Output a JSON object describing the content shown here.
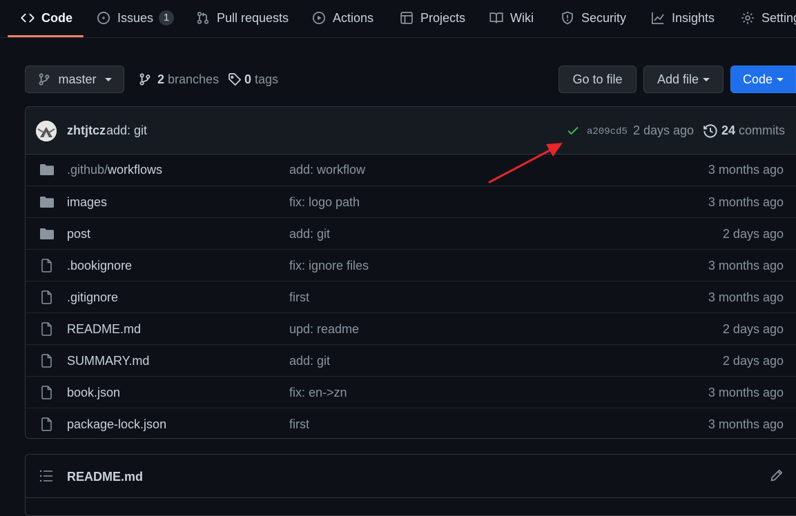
{
  "nav": {
    "tabs": [
      {
        "label": "Code",
        "icon": "code-icon",
        "active": true
      },
      {
        "label": "Issues",
        "icon": "issue-opened-icon",
        "count": "1"
      },
      {
        "label": "Pull requests",
        "icon": "git-pull-request-icon"
      },
      {
        "label": "Actions",
        "icon": "play-icon"
      },
      {
        "label": "Projects",
        "icon": "table-icon"
      },
      {
        "label": "Wiki",
        "icon": "book-icon"
      },
      {
        "label": "Security",
        "icon": "shield-icon"
      },
      {
        "label": "Insights",
        "icon": "graph-icon"
      },
      {
        "label": "Settings",
        "icon": "gear-icon"
      }
    ],
    "active_color": "#f78166"
  },
  "toolbar": {
    "branch": "master",
    "branches_count": "2",
    "branches_label": "branches",
    "tags_count": "0",
    "tags_label": "tags",
    "go_to_file": "Go to file",
    "add_file": "Add file",
    "code": "Code",
    "code_color": "#1f6feb"
  },
  "commit": {
    "author": "zhtjtcz",
    "message": "add: git",
    "status": "success",
    "status_color": "#3fb950",
    "sha": "a209cd5",
    "age": "2 days ago",
    "commits_count": "24",
    "commits_label": "commits"
  },
  "files": [
    {
      "type": "dir",
      "name_prefix": ".github/",
      "name": "workflows",
      "message": "add: workflow",
      "age": "3 months ago"
    },
    {
      "type": "dir",
      "name_prefix": "",
      "name": "images",
      "message": "fix: logo path",
      "age": "3 months ago"
    },
    {
      "type": "dir",
      "name_prefix": "",
      "name": "post",
      "message": "add: git",
      "age": "2 days ago"
    },
    {
      "type": "file",
      "name_prefix": "",
      "name": ".bookignore",
      "message": "fix: ignore files",
      "age": "3 months ago"
    },
    {
      "type": "file",
      "name_prefix": "",
      "name": ".gitignore",
      "message": "first",
      "age": "3 months ago"
    },
    {
      "type": "file",
      "name_prefix": "",
      "name": "README.md",
      "message": "upd: readme",
      "age": "2 days ago"
    },
    {
      "type": "file",
      "name_prefix": "",
      "name": "SUMMARY.md",
      "message": "add: git",
      "age": "2 days ago"
    },
    {
      "type": "file",
      "name_prefix": "",
      "name": "book.json",
      "message": "fix: en->zn",
      "age": "3 months ago"
    },
    {
      "type": "file",
      "name_prefix": "",
      "name": "package-lock.json",
      "message": "first",
      "age": "3 months ago"
    }
  ],
  "readme": {
    "title": "README.md"
  },
  "annotation": {
    "type": "arrow",
    "color": "#e5262b",
    "points_to": "commit status check"
  }
}
